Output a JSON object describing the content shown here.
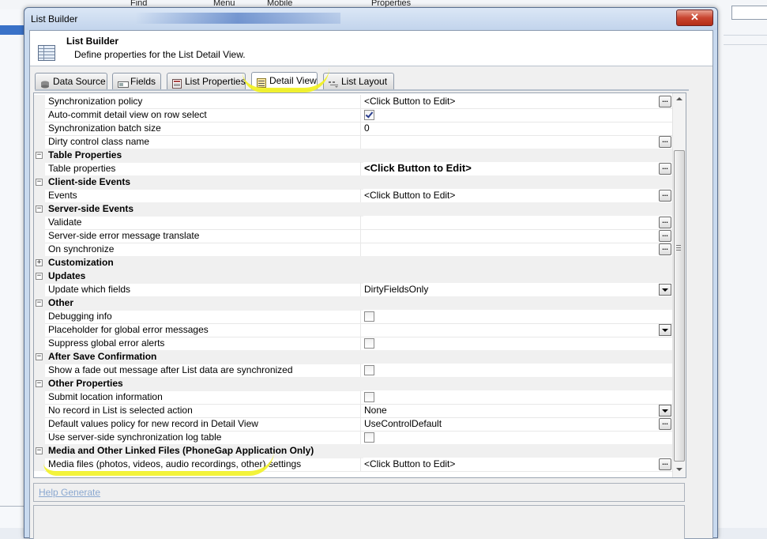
{
  "background": {
    "toolbar_items": [
      "Find",
      "Menu",
      "Mobile",
      "Properties"
    ]
  },
  "dialog": {
    "title": "List Builder",
    "close_glyph": "✕",
    "header": {
      "title": "List Builder",
      "subtitle": "Define properties for the List Detail View."
    },
    "tabs": [
      {
        "label": "Data Source",
        "icon": "database-icon"
      },
      {
        "label": "Fields",
        "icon": "fields-icon"
      },
      {
        "label": "List Properties",
        "icon": "list-properties-icon"
      },
      {
        "label": "Detail View",
        "icon": "detail-view-icon",
        "active": true
      },
      {
        "label": "List Layout",
        "icon": "list-layout-icon"
      }
    ],
    "grid_rows": [
      {
        "type": "prop",
        "name": "Synchronization policy",
        "value": "<Click Button to Edit>",
        "button": "ellipsis"
      },
      {
        "type": "prop",
        "name": "Auto-commit detail view on row select",
        "checkbox": true,
        "checked": true
      },
      {
        "type": "prop",
        "name": "Synchronization batch size",
        "value": "0"
      },
      {
        "type": "prop",
        "name": "Dirty control class name",
        "value": "",
        "button": "ellipsis"
      },
      {
        "type": "cat",
        "name": "Table Properties",
        "toggle": "⊟"
      },
      {
        "type": "prop",
        "name": "Table properties",
        "value": "<Click Button to Edit>",
        "bold": true,
        "button": "ellipsis"
      },
      {
        "type": "cat",
        "name": "Client-side Events",
        "toggle": "⊟"
      },
      {
        "type": "prop",
        "name": "Events",
        "value": "<Click Button to Edit>",
        "button": "ellipsis"
      },
      {
        "type": "cat",
        "name": "Server-side Events",
        "toggle": "⊟"
      },
      {
        "type": "prop",
        "name": "Validate",
        "value": "",
        "button": "ellipsis"
      },
      {
        "type": "prop",
        "name": "Server-side error message translate",
        "value": "",
        "button": "ellipsis"
      },
      {
        "type": "prop",
        "name": "On synchronize",
        "value": "",
        "button": "ellipsis"
      },
      {
        "type": "cat",
        "name": "Customization",
        "toggle": "⊞"
      },
      {
        "type": "cat",
        "name": "Updates",
        "toggle": "⊟"
      },
      {
        "type": "prop",
        "name": "Update which fields",
        "value": "DirtyFieldsOnly",
        "button": "dropdown"
      },
      {
        "type": "cat",
        "name": "Other",
        "toggle": "⊟"
      },
      {
        "type": "prop",
        "name": "Debugging info",
        "checkbox": true,
        "checked": false
      },
      {
        "type": "prop",
        "name": "Placeholder for global error messages",
        "value": "",
        "button": "dropdown"
      },
      {
        "type": "prop",
        "name": "Suppress global error alerts",
        "checkbox": true,
        "checked": false
      },
      {
        "type": "cat",
        "name": "After Save Confirmation",
        "toggle": "⊟"
      },
      {
        "type": "prop",
        "name": "Show a fade out message after List data are synchronized",
        "checkbox": true,
        "checked": false
      },
      {
        "type": "cat",
        "name": "Other Properties",
        "toggle": "⊟"
      },
      {
        "type": "prop",
        "name": "Submit location information",
        "checkbox": true,
        "checked": false
      },
      {
        "type": "prop",
        "name": "No record in List is selected action",
        "value": "None",
        "button": "dropdown"
      },
      {
        "type": "prop",
        "name": "Default values policy for new record in Detail View",
        "value": "UseControlDefault",
        "button": "ellipsis"
      },
      {
        "type": "prop",
        "name": "Use server-side synchronization log table",
        "checkbox": true,
        "checked": false
      },
      {
        "type": "cat",
        "name": "Media and Other Linked Files  (PhoneGap Application Only)",
        "toggle": "⊟"
      },
      {
        "type": "prop",
        "name": "Media files (photos, videos, audio recordings, other) settings",
        "value": "<Click Button to Edit>",
        "button": "ellipsis"
      }
    ],
    "ellipsis_glyph": "...",
    "help_link": "Help Generate",
    "highlight_color": "#f2f226"
  }
}
